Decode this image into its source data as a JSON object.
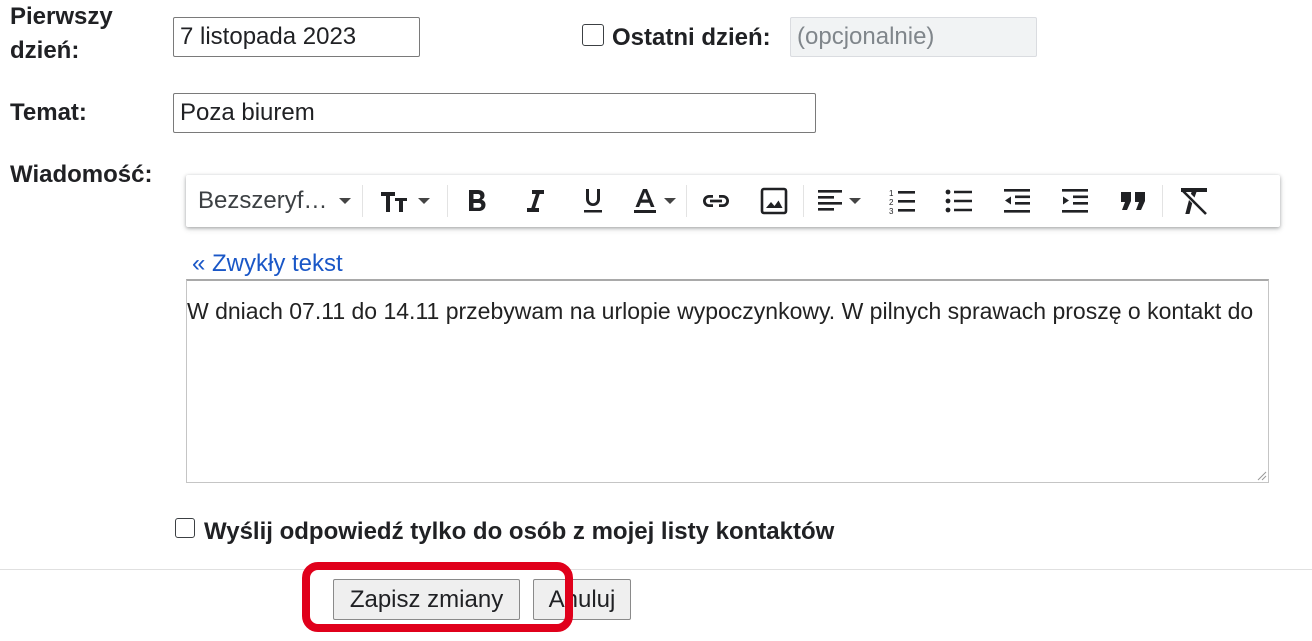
{
  "first_day": {
    "label": "Pierwszy dzień:",
    "value": "7 listopada 2023"
  },
  "last_day": {
    "label": "Ostatni dzień:",
    "checked": false,
    "placeholder": "(opcjonalnie)"
  },
  "subject": {
    "label": "Temat:",
    "value": "Poza biurem"
  },
  "message": {
    "label": "Wiadomość:",
    "plain_text_link": "« Zwykły tekst",
    "body": "W dniach 07.11 do 14.11 przebywam na urlopie wypoczynkowy. W pilnych sprawach proszę o kontakt do"
  },
  "toolbar": {
    "font_family": "Bezszeryf…",
    "items": [
      {
        "name": "font-size-icon"
      },
      {
        "name": "bold-icon"
      },
      {
        "name": "italic-icon"
      },
      {
        "name": "underline-icon"
      },
      {
        "name": "text-color-icon"
      },
      {
        "name": "link-icon"
      },
      {
        "name": "image-icon"
      },
      {
        "name": "align-icon"
      },
      {
        "name": "numbered-list-icon"
      },
      {
        "name": "bulleted-list-icon"
      },
      {
        "name": "indent-less-icon"
      },
      {
        "name": "indent-more-icon"
      },
      {
        "name": "quote-icon"
      },
      {
        "name": "remove-formatting-icon"
      }
    ]
  },
  "contacts_only": {
    "label": "Wyślij odpowiedź tylko do osób z mojej listy kontaktów",
    "checked": false
  },
  "actions": {
    "save_label": "Zapisz zmiany",
    "cancel_label": "Anuluj"
  },
  "colors": {
    "link": "#1a57c7",
    "highlight": "#e0001b"
  }
}
